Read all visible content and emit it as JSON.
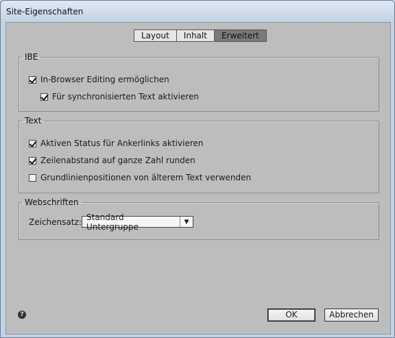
{
  "window": {
    "title": "Site-Eigenschaften"
  },
  "tabs": [
    {
      "label": "Layout",
      "active": false
    },
    {
      "label": "Inhalt",
      "active": false
    },
    {
      "label": "Erweitert",
      "active": true
    }
  ],
  "ibe": {
    "legend": "IBE",
    "enable_editing": {
      "label": "In-Browser Editing ermöglichen",
      "checked": true
    },
    "sync_text": {
      "label": "Für synchronisierten Text aktivieren",
      "checked": true
    }
  },
  "text": {
    "legend": "Text",
    "anchor_status": {
      "label": "Aktiven Status für Ankerlinks aktivieren",
      "checked": true
    },
    "round_line_height": {
      "label": "Zeilenabstand auf ganze Zahl runden",
      "checked": true
    },
    "legacy_baseline": {
      "label": "Grundlinienpositionen von älterem Text verwenden",
      "checked": false
    }
  },
  "webfonts": {
    "legend": "Webschriften",
    "charset_label": "Zeichensatz:",
    "charset_value": "Standard Untergruppe"
  },
  "footer": {
    "help_icon": "?",
    "ok_label": "OK",
    "cancel_label": "Abbrechen"
  }
}
